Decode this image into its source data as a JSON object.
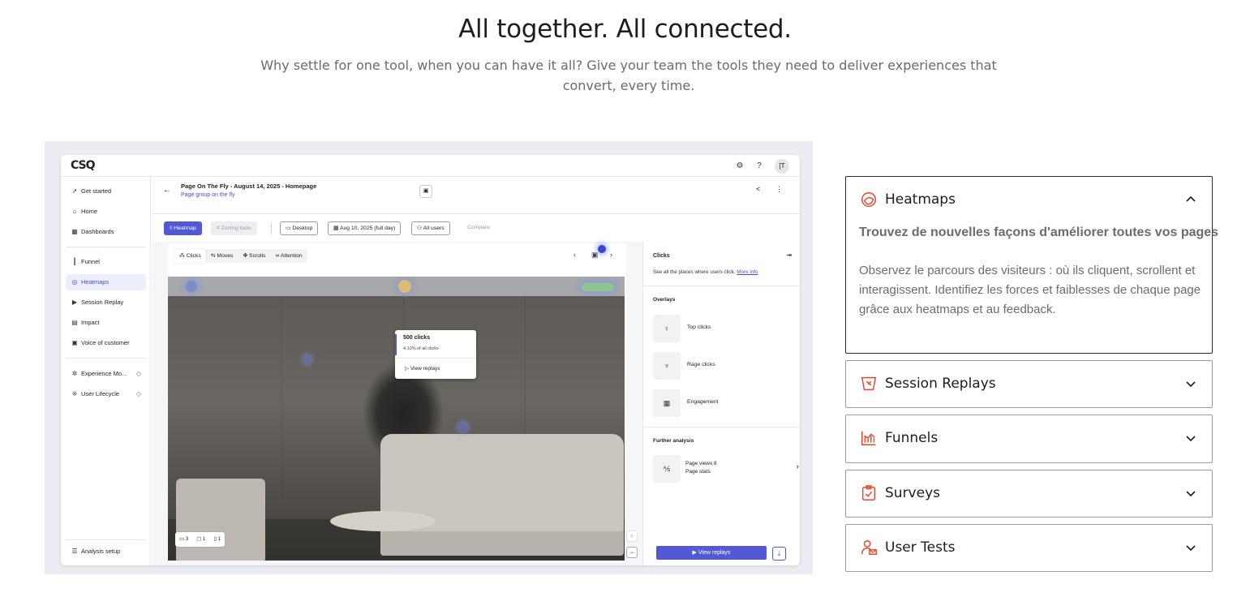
{
  "hero": {
    "title": "All together. All connected.",
    "subtitle": "Why settle for one tool, when you can have it all? Give your team the tools they need to deliver experiences that convert, every time."
  },
  "app": {
    "logo": "CSQ",
    "avatar_initials": "[T",
    "sidebar": [
      {
        "icon": "rocket-icon",
        "label": "Get started"
      },
      {
        "icon": "home-icon",
        "label": "Home"
      },
      {
        "icon": "dashboard-icon",
        "label": "Dashboards"
      },
      {
        "icon": "funnel-icon",
        "label": "Funnel"
      },
      {
        "icon": "heatmap-icon",
        "label": "Heatmaps",
        "active": true
      },
      {
        "icon": "replay-icon",
        "label": "Session Replay"
      },
      {
        "icon": "impact-icon",
        "label": "Impact"
      },
      {
        "icon": "voice-icon",
        "label": "Voice of customer"
      },
      {
        "icon": "bug-icon",
        "label": "Experience Mo..."
      },
      {
        "icon": "lifecycle-icon",
        "label": "User Lifecycle"
      }
    ],
    "analysis_setup": "Analysis setup",
    "page_title": "Page On The Fly - August 14, 2025 - Homepage",
    "page_group": "Page group on the fly",
    "toolbar": {
      "heatmap": "Heatmap",
      "zoning": "Zoning tools",
      "device": "Desktop",
      "date": "Aug 10, 2025 (full day)",
      "users": "All users",
      "compare": "Compare"
    },
    "viewer_tabs": [
      "Clicks",
      "Moves",
      "Scrolls",
      "Attention"
    ],
    "popup": {
      "clicks": "500 clicks",
      "share": "4.10% of all clicks",
      "replays": "View replays"
    },
    "counts": [
      "3",
      "1",
      "1"
    ],
    "right_panel": {
      "title": "Clicks",
      "desc": "See all the places where users click.",
      "more_info": "More info",
      "overlays_title": "Overlays",
      "overlays": [
        "Top clicks",
        "Rage clicks",
        "Engagement"
      ],
      "further_title": "Further analysis",
      "further_line1": "Page views 8",
      "further_line2": "Page stats",
      "view_replays": "View replays"
    }
  },
  "accordion": [
    {
      "icon": "heatmaps-icon",
      "title": "Heatmaps",
      "expanded": true,
      "headline": "Trouvez de nouvelles façons d'améliorer toutes vos pages",
      "body": "Observez le parcours des visiteurs : où ils cliquent, scrollent et interagissent. Identifiez les forces et faiblesses de chaque page grâce aux heatmaps et au feedback."
    },
    {
      "icon": "session-replays-icon",
      "title": "Session Replays",
      "expanded": false
    },
    {
      "icon": "funnels-icon",
      "title": "Funnels",
      "expanded": false
    },
    {
      "icon": "surveys-icon",
      "title": "Surveys",
      "expanded": false
    },
    {
      "icon": "user-tests-icon",
      "title": "User Tests",
      "expanded": false
    }
  ],
  "colors": {
    "accent": "#e8472c",
    "app_primary": "#5358d6"
  }
}
